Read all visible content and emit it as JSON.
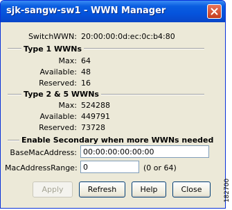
{
  "window": {
    "title": "sjk-sangw-sw1 - WWN Manager"
  },
  "switch_wwn": {
    "label": "SwitchWWN:",
    "value": "20:00:00:0d:ec:0c:b4:80"
  },
  "type1": {
    "title": "Type 1 WWNs",
    "max_label": "Max:",
    "max": "64",
    "available_label": "Available:",
    "available": "48",
    "reserved_label": "Reserved:",
    "reserved": "16"
  },
  "type25": {
    "title": "Type 2 & 5 WWNs",
    "max_label": "Max:",
    "max": "524288",
    "available_label": "Available:",
    "available": "449791",
    "reserved_label": "Reserved:",
    "reserved": "73728"
  },
  "secondary": {
    "title": "Enable Secondary when more WWNs needed",
    "base_mac_label": "BaseMacAddress:",
    "base_mac_value": "00:00:00:00:00:00",
    "mac_range_label": "MacAddressRange:",
    "mac_range_value": "0",
    "mac_range_hint": "(0 or 64)"
  },
  "buttons": {
    "apply": "Apply",
    "refresh": "Refresh",
    "help": "Help",
    "close": "Close"
  },
  "figure_code": "182700"
}
